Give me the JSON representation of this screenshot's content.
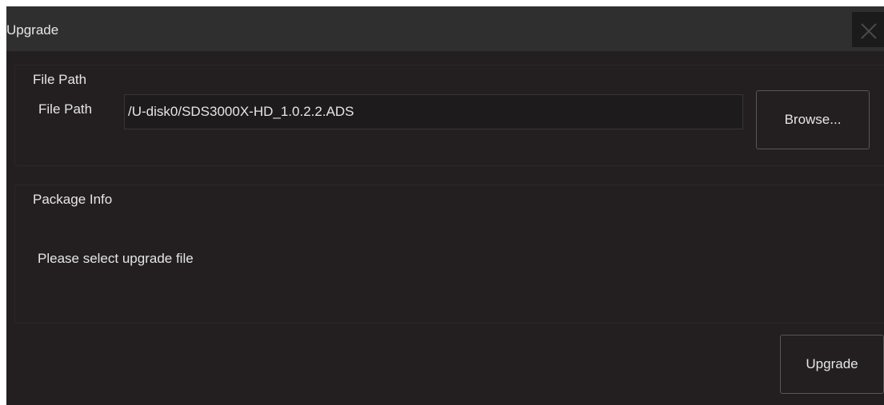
{
  "dialog": {
    "title": "Upgrade",
    "close_icon": "close-icon"
  },
  "file_path_group": {
    "title": "File Path",
    "field_label": "File Path",
    "path_value": "/U-disk0/SDS3000X-HD_1.0.2.2.ADS",
    "browse_label": "Browse..."
  },
  "package_info_group": {
    "title": "Package Info",
    "message": "Please select upgrade file"
  },
  "footer": {
    "upgrade_label": "Upgrade"
  },
  "colors": {
    "background": "#231f20",
    "title_bar": "#2f2f2f",
    "text": "#e6e6e6",
    "button_border": "#5a5657"
  }
}
